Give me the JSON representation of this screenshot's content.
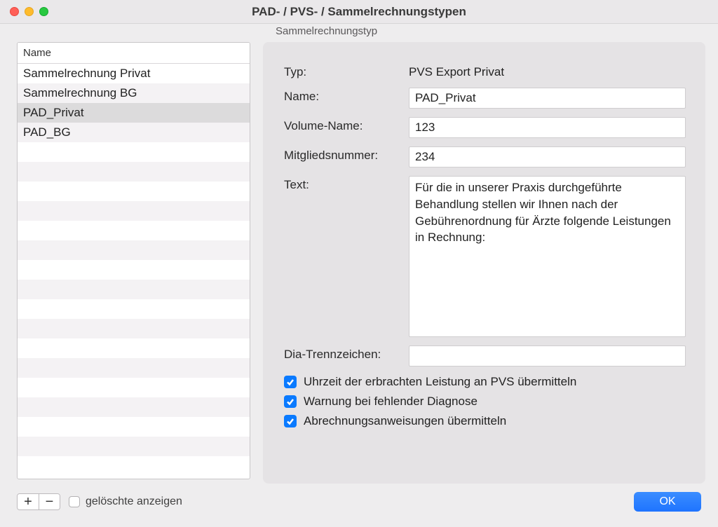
{
  "window": {
    "title": "PAD- / PVS- / Sammelrechnungstypen"
  },
  "list": {
    "header": "Name",
    "items": [
      {
        "label": "Sammelrechnung Privat",
        "selected": false
      },
      {
        "label": "Sammelrechnung BG",
        "selected": false
      },
      {
        "label": "PAD_Privat",
        "selected": true
      },
      {
        "label": "PAD_BG",
        "selected": false
      }
    ],
    "empty_rows": 16
  },
  "panel": {
    "legend": "Sammelrechnungstyp",
    "labels": {
      "typ": "Typ:",
      "name": "Name:",
      "volume": "Volume-Name:",
      "mitglied": "Mitgliedsnummer:",
      "text": "Text:",
      "dia": "Dia-Trennzeichen:"
    },
    "values": {
      "typ": "PVS Export Privat",
      "name": "PAD_Privat",
      "volume": "123",
      "mitglied": "234",
      "text": "Für die in unserer Praxis durchgeführte Behandlung stellen wir Ihnen nach der Gebührenordnung für Ärzte folgende Leistungen in Rechnung:",
      "dia": ""
    },
    "checkboxes": [
      {
        "label": "Uhrzeit der erbrachten Leistung an PVS übermitteln",
        "checked": true
      },
      {
        "label": "Warnung bei fehlender Diagnose",
        "checked": true
      },
      {
        "label": "Abrechnungsanweisungen übermitteln",
        "checked": true
      }
    ]
  },
  "toolbar": {
    "add": "+",
    "remove": "−",
    "show_deleted_label": "gelöschte anzeigen",
    "show_deleted_checked": false,
    "ok": "OK"
  }
}
